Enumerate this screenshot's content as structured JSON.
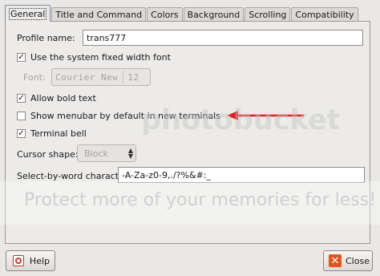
{
  "tabs": [
    "General",
    "Title and Command",
    "Colors",
    "Background",
    "Scrolling",
    "Compatibility"
  ],
  "profile_name": {
    "label": "Profile name:",
    "value": "trans777"
  },
  "system_font": {
    "label": "Use the system fixed width font",
    "checked": true
  },
  "font": {
    "label": "Font:",
    "name": "Courier New",
    "size": "12"
  },
  "allow_bold": {
    "label": "Allow bold text",
    "checked": true
  },
  "show_menubar": {
    "label": "Show menubar by default in new terminals",
    "checked": false
  },
  "terminal_bell": {
    "label": "Terminal bell",
    "checked": true
  },
  "cursor_shape": {
    "label": "Cursor shape:",
    "value": "Block"
  },
  "select_by_word": {
    "label": "Select-by-word characters:",
    "value": "-A-Za-z0-9,./?%&#:_"
  },
  "buttons": {
    "help": "Help",
    "close": "Close"
  },
  "annotation": {
    "arrow_color": "#e02020"
  },
  "watermark": {
    "brand": "photobucket",
    "tagline": "Protect more of your memories for less!"
  }
}
